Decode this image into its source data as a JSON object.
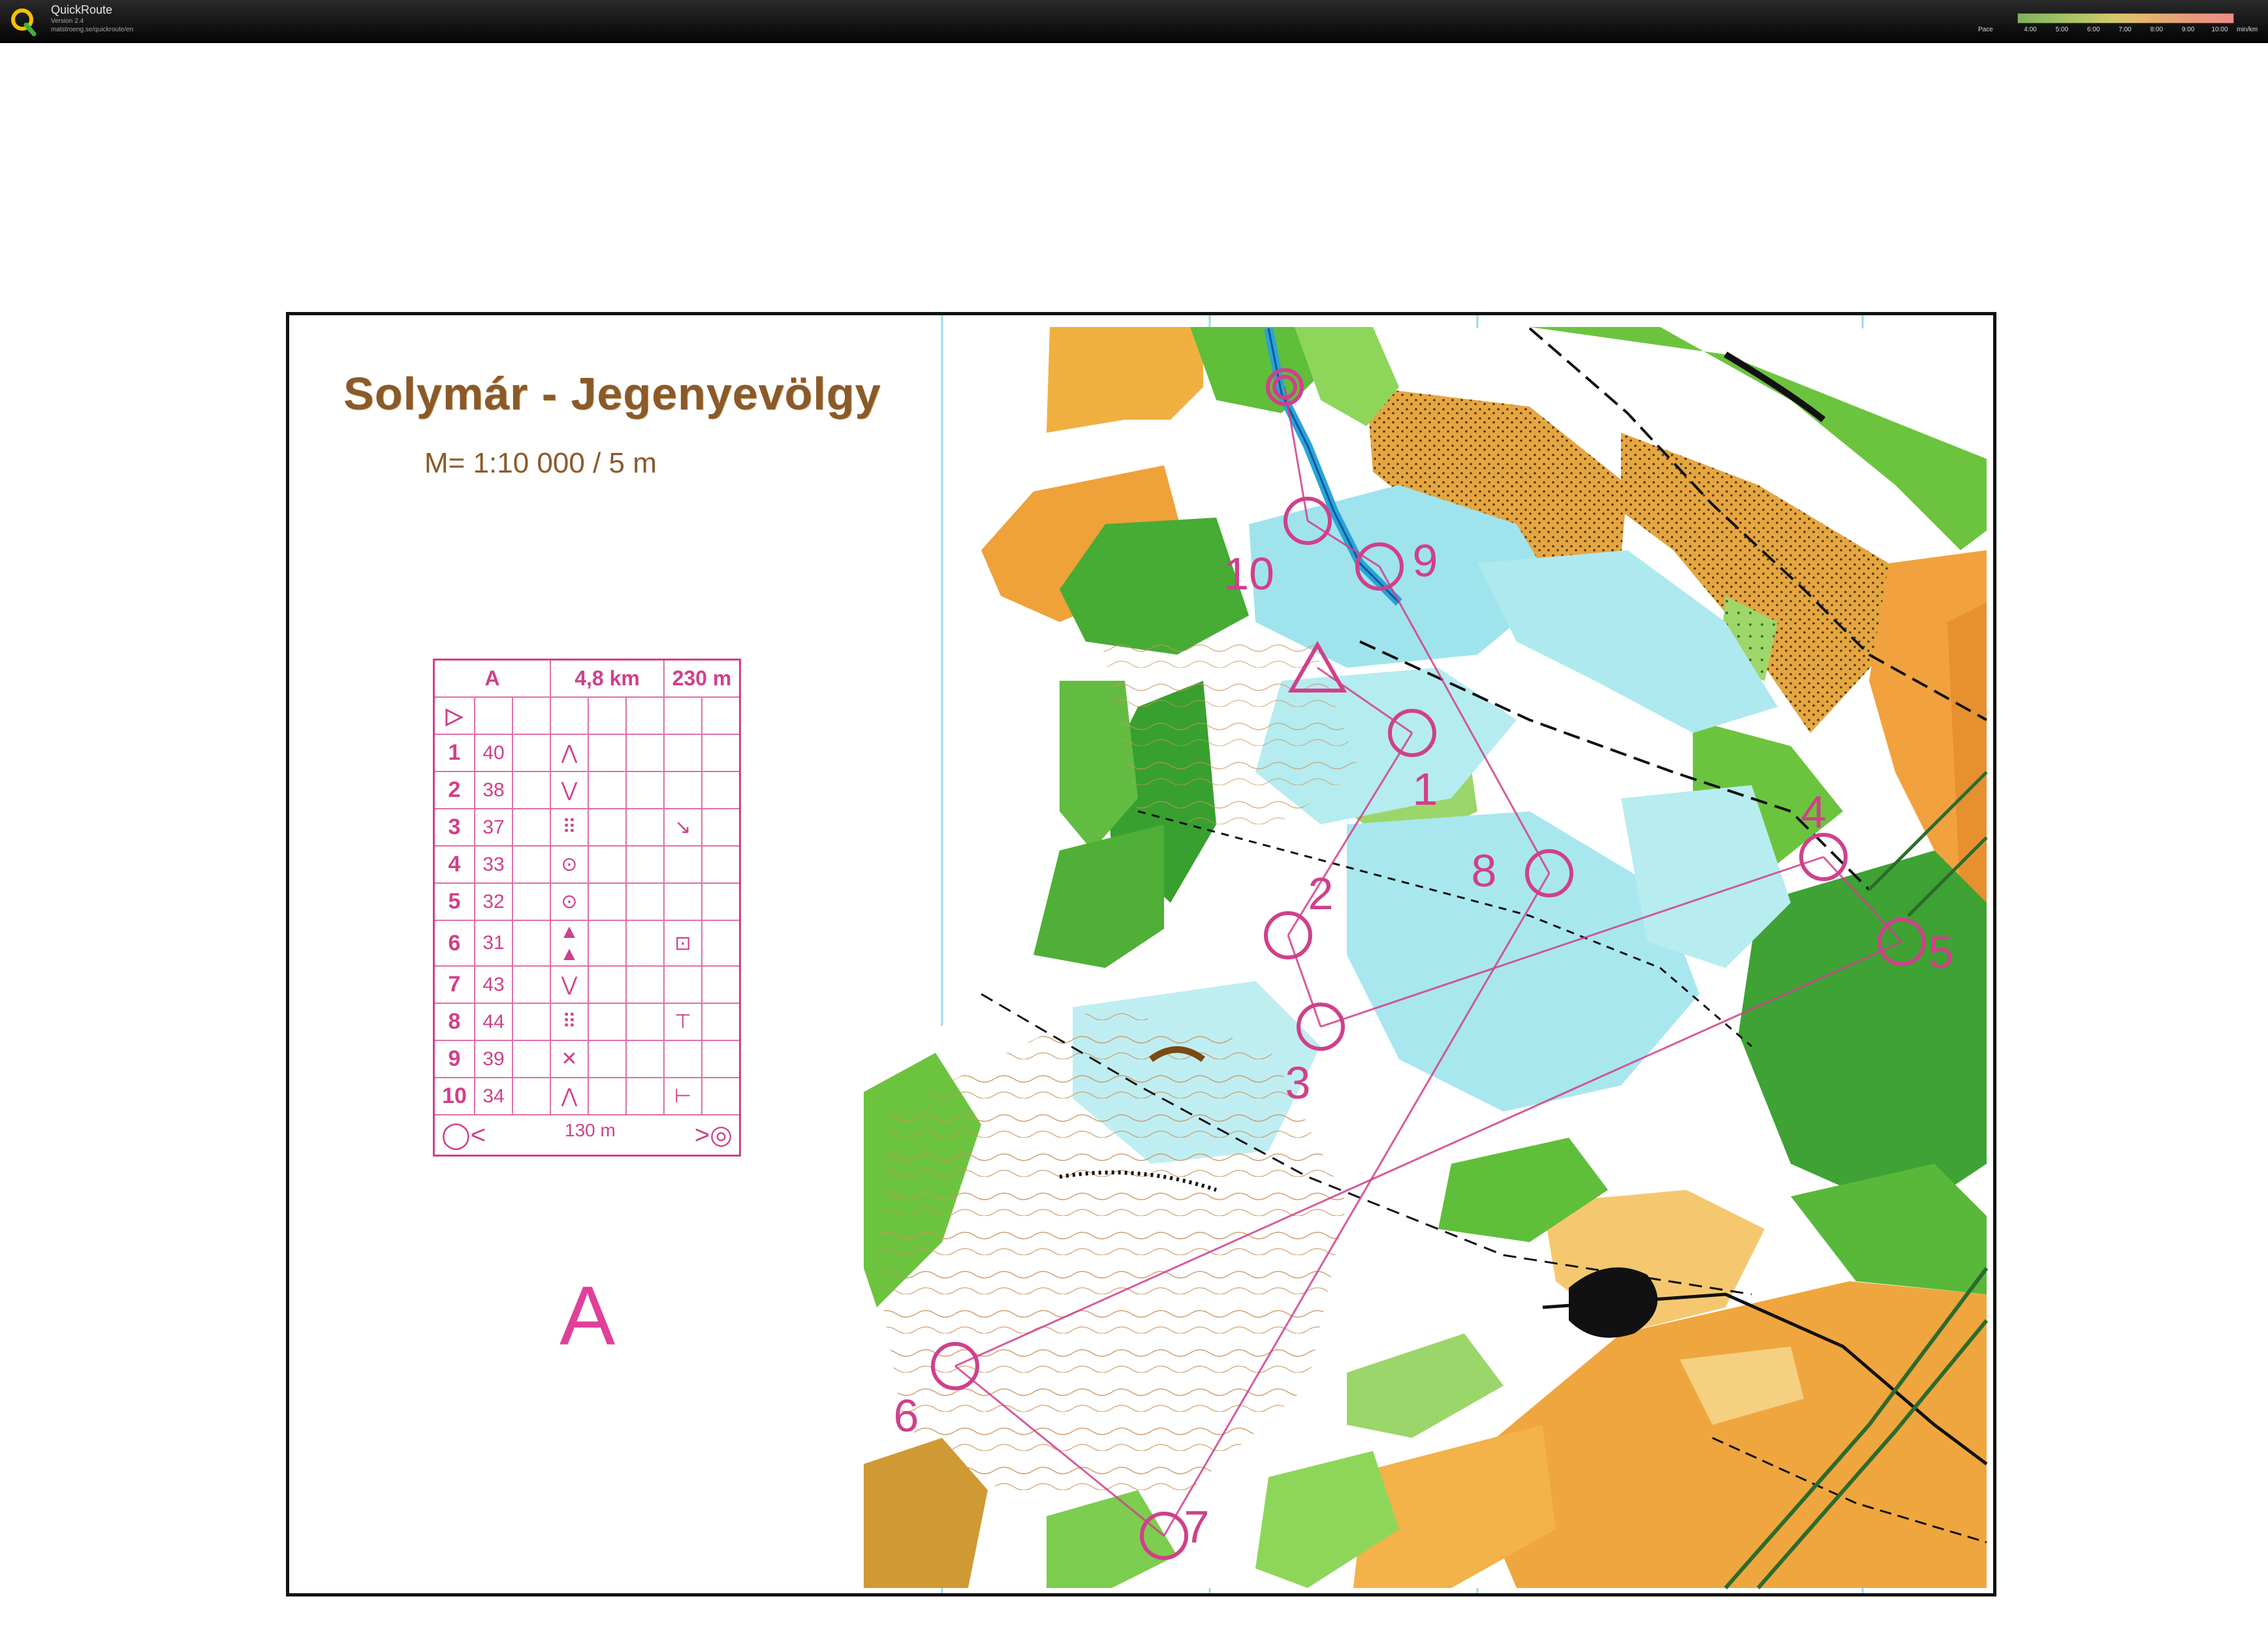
{
  "app": {
    "name": "QuickRoute",
    "version": "Version 2.4",
    "url": "matstroeng.se/quickroute/en"
  },
  "pace_legend": {
    "label": "Pace",
    "ticks": [
      "4:00",
      "5:00",
      "6:00",
      "7:00",
      "8:00",
      "9:00",
      "10:00"
    ],
    "unit": "min/km"
  },
  "map": {
    "title": "Solymár - Jegenyevölgy",
    "scale": "M= 1:10 000 / 5 m",
    "course_letter": "A",
    "course_color": "#d0408a"
  },
  "control_description": {
    "course": "A",
    "length": "4,8 km",
    "climb": "230 m",
    "start_symbol": "▷",
    "rows": [
      {
        "num": "1",
        "code": "40",
        "feature": "⋀",
        "position": ""
      },
      {
        "num": "2",
        "code": "38",
        "feature": "⋁",
        "position": ""
      },
      {
        "num": "3",
        "code": "37",
        "feature": "⠿",
        "position": "↘"
      },
      {
        "num": "4",
        "code": "33",
        "feature": "⊙",
        "position": ""
      },
      {
        "num": "5",
        "code": "32",
        "feature": "⊙",
        "position": ""
      },
      {
        "num": "6",
        "code": "31",
        "feature": "▲ ▲",
        "position": "⊡"
      },
      {
        "num": "7",
        "code": "43",
        "feature": "⋁",
        "position": ""
      },
      {
        "num": "8",
        "code": "44",
        "feature": "⠿",
        "position": "⊤"
      },
      {
        "num": "9",
        "code": "39",
        "feature": "✕",
        "position": ""
      },
      {
        "num": "10",
        "code": "34",
        "feature": "⋀",
        "position": "⊢"
      }
    ],
    "finish_distance": "130 m"
  },
  "course_controls": [
    {
      "label": "1"
    },
    {
      "label": "2"
    },
    {
      "label": "3"
    },
    {
      "label": "4"
    },
    {
      "label": "5"
    },
    {
      "label": "6"
    },
    {
      "label": "7"
    },
    {
      "label": "8"
    },
    {
      "label": "9"
    },
    {
      "label": "10"
    }
  ]
}
